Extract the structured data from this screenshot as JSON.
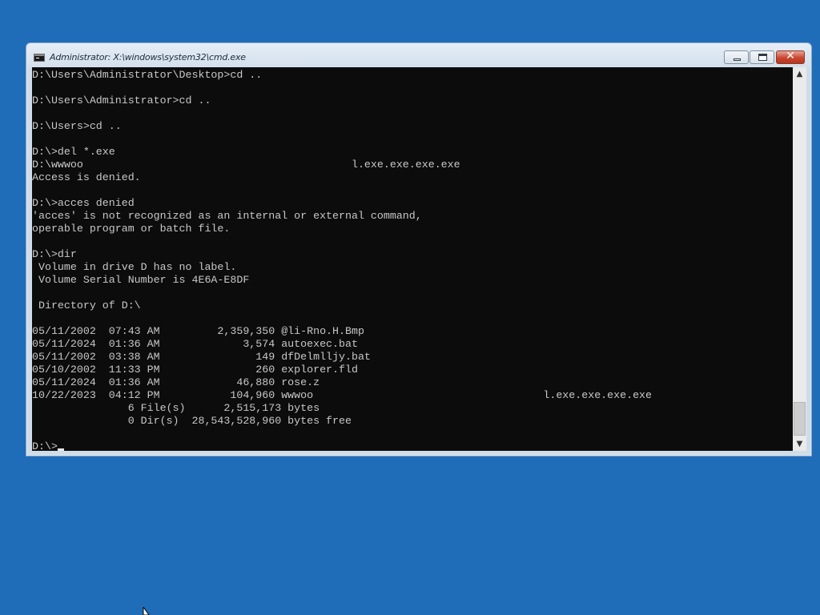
{
  "window": {
    "title": "Administrator: X:\\windows\\system32\\cmd.exe",
    "icon": "cmd-icon"
  },
  "controls": {
    "close_glyph": "✕"
  },
  "scrollbar": {
    "up_arrow": "▲",
    "down_arrow": "▼",
    "thumb_position": 0.9
  },
  "console": {
    "prompt": "D:\\>",
    "lines": [
      "D:\\Users\\Administrator\\Desktop>cd ..",
      "",
      "D:\\Users\\Administrator>cd ..",
      "",
      "D:\\Users>cd ..",
      "",
      "D:\\>del *.exe",
      "D:\\wwwoo                                          l.exe.exe.exe.exe",
      "Access is denied.",
      "",
      "D:\\>acces denied",
      "'acces' is not recognized as an internal or external command,",
      "operable program or batch file.",
      "",
      "D:\\>dir",
      " Volume in drive D has no label.",
      " Volume Serial Number is 4E6A-E8DF",
      "",
      " Directory of D:\\",
      "",
      "05/11/2002  07:43 AM         2,359,350 @li-Rno.H.Bmp",
      "05/11/2024  01:36 AM             3,574 autoexec.bat",
      "05/11/2002  03:38 AM               149 dfDelmlljy.bat",
      "05/10/2002  11:33 PM               260 explorer.fld",
      "05/11/2024  01:36 AM            46,880 rose.z",
      "10/22/2023  04:12 PM           104,960 wwwoo                                    l.exe.exe.exe.exe",
      "               6 File(s)      2,515,173 bytes",
      "               0 Dir(s)  28,543,528,960 bytes free",
      ""
    ]
  },
  "colors": {
    "desktop": "#1f6cb8",
    "console_bg": "#0c0c0c",
    "console_text": "#c8c8c8",
    "close_button": "#c9462f"
  }
}
